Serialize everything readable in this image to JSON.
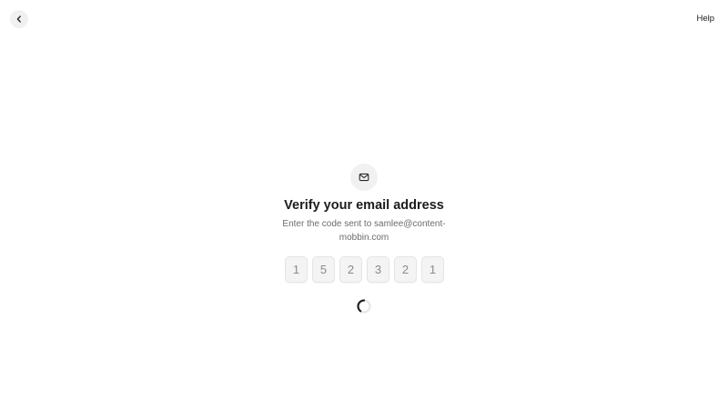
{
  "header": {
    "back_icon": "chevron-left-icon",
    "help_label": "Help"
  },
  "verify": {
    "badge_icon": "mail-icon",
    "title": "Verify your email address",
    "subtitle_line1": "Enter the code sent to samlee@content-",
    "subtitle_line2": "mobbin.com",
    "code_digits": [
      "1",
      "5",
      "2",
      "3",
      "2",
      "1"
    ],
    "status_icon": "loading-spinner-icon"
  },
  "colors": {
    "background": "#ffffff",
    "text_primary": "#1c1c1c",
    "text_secondary": "#6b6b6b",
    "code_digit": "#8a8a8a",
    "badge_bg": "#f1f1f1"
  }
}
